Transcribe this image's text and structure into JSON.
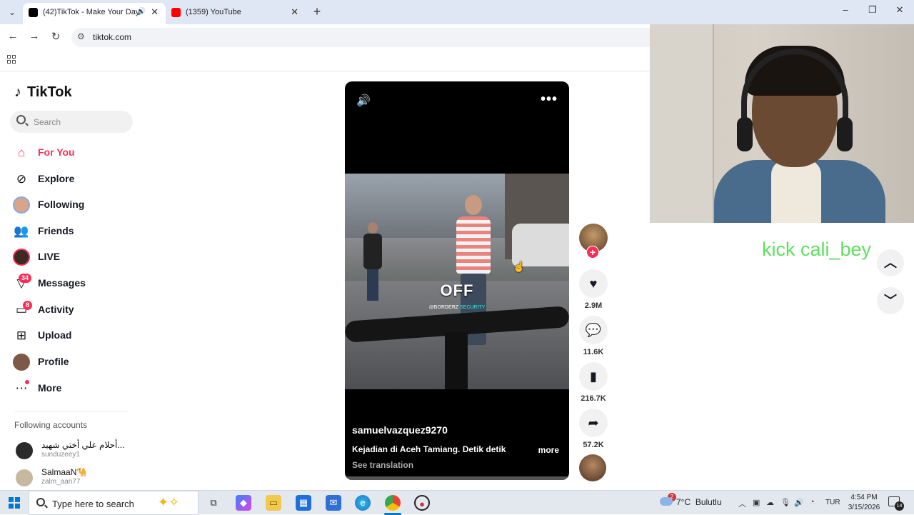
{
  "browser": {
    "tabs": [
      {
        "title": "(42)TikTok - Make Your Day",
        "active": true,
        "favicon_color": "#000000"
      },
      {
        "title": "(1359) YouTube",
        "active": false,
        "favicon_color": "#ff0000"
      }
    ],
    "url": "tiktok.com"
  },
  "tiktok": {
    "logo": "TikTok",
    "search_placeholder": "Search",
    "nav": [
      {
        "label": "For You",
        "icon": "home-icon",
        "active": true
      },
      {
        "label": "Explore",
        "icon": "compass-icon"
      },
      {
        "label": "Following",
        "icon": "following-avatar-icon"
      },
      {
        "label": "Friends",
        "icon": "friends-icon"
      },
      {
        "label": "LIVE",
        "icon": "live-icon"
      },
      {
        "label": "Messages",
        "icon": "messages-icon",
        "badge": "34"
      },
      {
        "label": "Activity",
        "icon": "activity-icon",
        "badge": "8"
      },
      {
        "label": "Upload",
        "icon": "upload-icon"
      },
      {
        "label": "Profile",
        "icon": "profile-avatar-icon"
      },
      {
        "label": "More",
        "icon": "more-icon"
      }
    ],
    "following_title": "Following accounts",
    "following_accounts": [
      {
        "name": "أحلام علي أختي شهيد...",
        "handle": "sunduzeey1"
      },
      {
        "name": "SalmaaN🐪",
        "handle": "zalm_aan77"
      }
    ],
    "video": {
      "overlay_text": "OFF",
      "watermark_prefix": "@BORDERZ ",
      "watermark_accent": "SECURITY",
      "author": "samuelvazquez9270",
      "caption": "Kejadian di Aceh Tamiang. Detik detik",
      "more": "more",
      "see_translation": "See translation"
    },
    "actions": {
      "likes": "2.9M",
      "comments": "11.6K",
      "saves": "216.7K",
      "shares": "57.2K"
    }
  },
  "stream_overlay": {
    "text": "kick cali_bey",
    "text_color": "#5de05d"
  },
  "taskbar": {
    "search_placeholder": "Type here to search",
    "weather_temp": "7°C",
    "weather_desc": "Bulutlu",
    "weather_badge": "2",
    "language": "TUR",
    "time": "4:54 PM",
    "date": "3/15/2026",
    "notifications": "14"
  }
}
